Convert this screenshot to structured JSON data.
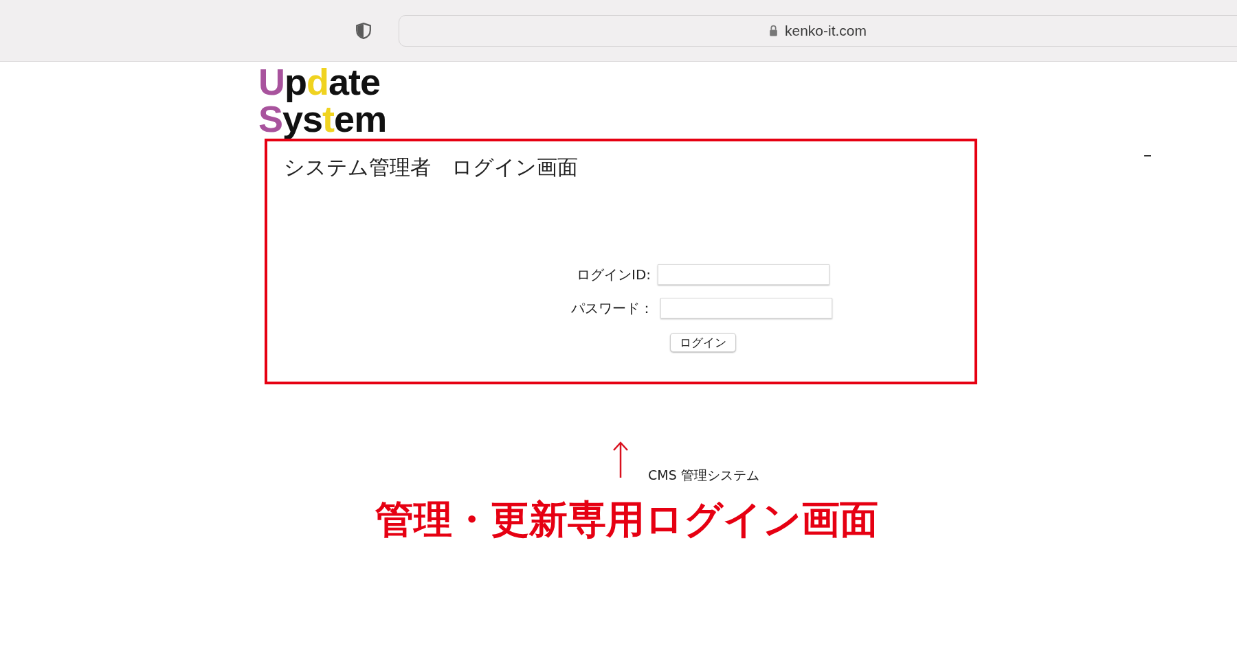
{
  "browser": {
    "address": "kenko-it.com"
  },
  "logo": {
    "lines": [
      [
        {
          "text": "U",
          "color": "#a8539d"
        },
        {
          "text": "p",
          "color": "#111111"
        },
        {
          "text": "d",
          "color": "#f0d320"
        },
        {
          "text": "ate",
          "color": "#111111"
        }
      ],
      [
        {
          "text": "S",
          "color": "#a8539d"
        },
        {
          "text": "ys",
          "color": "#111111"
        },
        {
          "text": "t",
          "color": "#f0d320"
        },
        {
          "text": "em",
          "color": "#111111"
        }
      ]
    ]
  },
  "login_panel": {
    "title": "システム管理者　ログイン画面",
    "fields": [
      {
        "label": "ログインID:"
      },
      {
        "label": "パスワード："
      }
    ],
    "button": "ログイン"
  },
  "annotation": {
    "caption": "CMS 管理システム",
    "headline": "管理・更新専用ログイン画面"
  }
}
